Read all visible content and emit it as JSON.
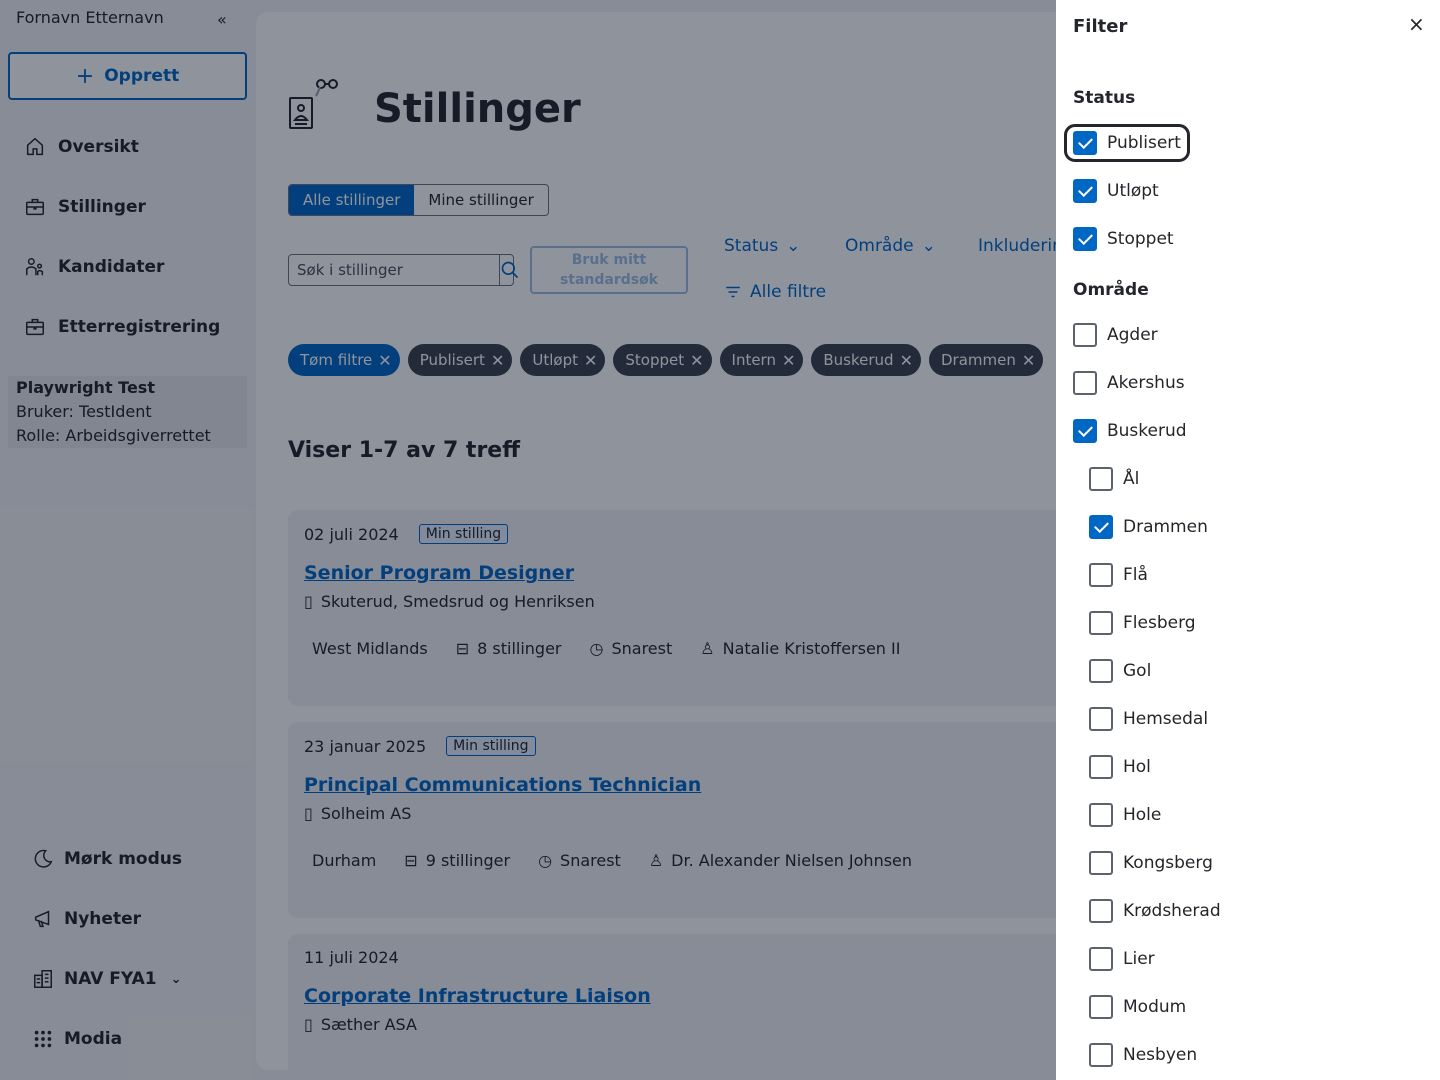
{
  "sidebar": {
    "user_name": "Fornavn Etternavn",
    "collapse_glyph": "«",
    "create_label": "Opprett",
    "nav": [
      {
        "label": "Oversikt",
        "icon": "home-icon"
      },
      {
        "label": "Stillinger",
        "icon": "briefcase-icon"
      },
      {
        "label": "Kandidater",
        "icon": "people-icon"
      },
      {
        "label": "Etterregistrering",
        "icon": "briefcase-icon"
      }
    ],
    "test": {
      "name": "Playwright Test",
      "user": "Bruker: TestIdent",
      "role": "Rolle: Arbeidsgiverrettet"
    },
    "bottom": [
      {
        "label": "Mørk modus",
        "icon": "moon-icon"
      },
      {
        "label": "Nyheter",
        "icon": "megaphone-icon"
      },
      {
        "label": "NAV FYA1",
        "icon": "building-icon"
      },
      {
        "label": "Modia",
        "icon": "grid-icon"
      }
    ]
  },
  "main": {
    "title": "Stillinger",
    "toggle": [
      "Alle stillinger",
      "Mine stillinger"
    ],
    "search_placeholder": "Søk i stillinger",
    "std_search": "Bruk mitt standardsøk",
    "dropdowns": [
      "Status",
      "Område",
      "Inkludering"
    ],
    "all_filters": "Alle filtre",
    "chips": [
      "Tøm filtre",
      "Publisert",
      "Utløpt",
      "Stoppet",
      "Intern",
      "Buskerud",
      "Drammen"
    ],
    "results": "Viser 1-7 av 7 treff",
    "cards": [
      {
        "date": "02 juli 2024",
        "tag": "Min stilling",
        "title": "Senior Program Designer",
        "employer": "Skuterud, Smedsrud og Henriksen",
        "location": "West Midlands",
        "positions": "8 stillinger",
        "deadline": "Snarest",
        "contact": "Natalie Kristoffersen II"
      },
      {
        "date": "23 januar 2025",
        "tag": "Min stilling",
        "title": "Principal Communications Technician",
        "employer": "Solheim AS",
        "location": "Durham",
        "positions": "9 stillinger",
        "deadline": "Snarest",
        "contact": "Dr. Alexander Nielsen Johnsen"
      },
      {
        "date": "11 juli 2024",
        "tag": "",
        "title": "Corporate Infrastructure Liaison",
        "employer": "Sæther ASA",
        "location": "",
        "positions": "",
        "deadline": "",
        "contact": ""
      }
    ]
  },
  "filter": {
    "title": "Filter",
    "close_glyph": "×",
    "status_heading": "Status",
    "status": [
      {
        "label": "Publisert",
        "checked": true
      },
      {
        "label": "Utløpt",
        "checked": true
      },
      {
        "label": "Stoppet",
        "checked": true
      }
    ],
    "area_heading": "Område",
    "areas": [
      {
        "label": "Agder",
        "checked": false,
        "level": 0
      },
      {
        "label": "Akershus",
        "checked": false,
        "level": 0
      },
      {
        "label": "Buskerud",
        "checked": true,
        "level": 0
      },
      {
        "label": "Ål",
        "checked": false,
        "level": 1
      },
      {
        "label": "Drammen",
        "checked": true,
        "level": 1
      },
      {
        "label": "Flå",
        "checked": false,
        "level": 1
      },
      {
        "label": "Flesberg",
        "checked": false,
        "level": 1
      },
      {
        "label": "Gol",
        "checked": false,
        "level": 1
      },
      {
        "label": "Hemsedal",
        "checked": false,
        "level": 1
      },
      {
        "label": "Hol",
        "checked": false,
        "level": 1
      },
      {
        "label": "Hole",
        "checked": false,
        "level": 1
      },
      {
        "label": "Kongsberg",
        "checked": false,
        "level": 1
      },
      {
        "label": "Krødsherad",
        "checked": false,
        "level": 1
      },
      {
        "label": "Lier",
        "checked": false,
        "level": 1
      },
      {
        "label": "Modum",
        "checked": false,
        "level": 1
      },
      {
        "label": "Nesbyen",
        "checked": false,
        "level": 1
      }
    ]
  }
}
